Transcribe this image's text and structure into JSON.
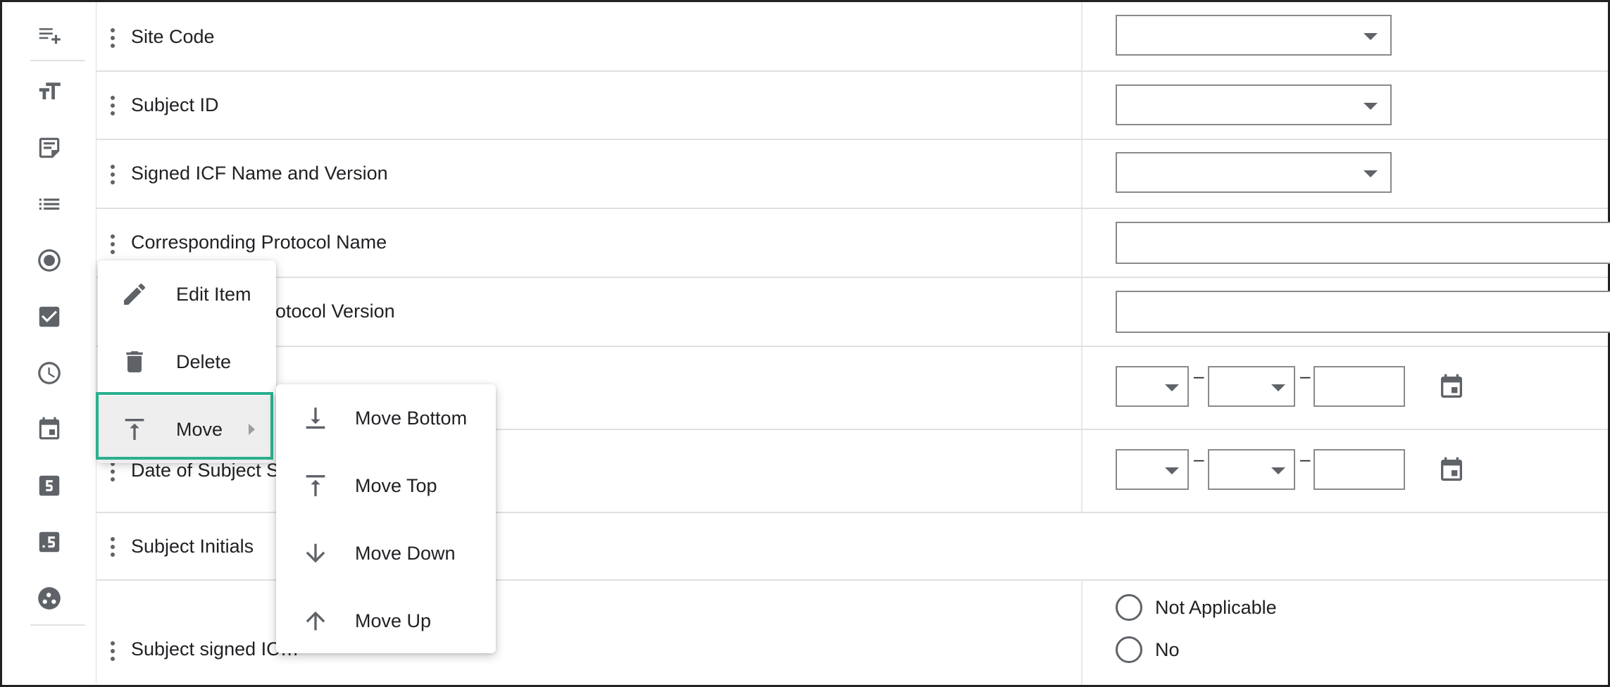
{
  "toolbar": {
    "icons": [
      "add-item-icon",
      "text-size-icon",
      "note-icon",
      "list-icon",
      "radio-icon",
      "checkbox-icon",
      "clock-icon",
      "calendar-icon",
      "number-five-icon",
      "decimal-five-icon",
      "group-icon"
    ]
  },
  "rows": [
    {
      "label": "Site Code"
    },
    {
      "label": "Subject ID"
    },
    {
      "label": "Signed ICF Name and Version"
    },
    {
      "label": "Corresponding Protocol Name"
    },
    {
      "label": "rotocol Version"
    },
    {
      "label": ""
    },
    {
      "label": "Date of Subject S"
    },
    {
      "label": "Subject Initials"
    },
    {
      "label": "Subject signed IC…"
    }
  ],
  "date_separator": "–",
  "radio_options": [
    "Not Applicable",
    "No"
  ],
  "context_menu": {
    "items": [
      {
        "label": "Edit Item",
        "icon": "pencil-icon"
      },
      {
        "label": "Delete",
        "icon": "trash-icon"
      },
      {
        "label": "Move",
        "icon": "move-top-icon"
      }
    ]
  },
  "move_submenu": {
    "items": [
      {
        "label": "Move Bottom",
        "icon": "move-bottom-icon"
      },
      {
        "label": "Move Top",
        "icon": "move-top-icon"
      },
      {
        "label": "Move Down",
        "icon": "arrow-down-icon"
      },
      {
        "label": "Move Up",
        "icon": "arrow-up-icon"
      }
    ]
  },
  "colors": {
    "highlight": "#2bb08f",
    "icon": "#5f6368",
    "border": "#8a8a8a"
  }
}
